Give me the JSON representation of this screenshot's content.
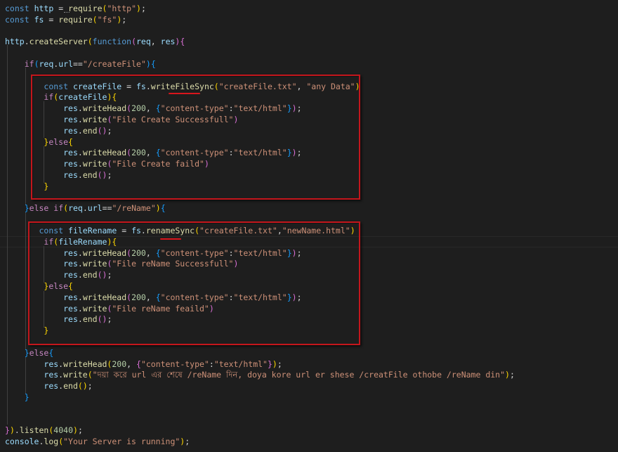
{
  "editor": {
    "lines": [
      [
        {
          "t": "const",
          "c": "kw"
        },
        {
          "t": " ",
          "c": "p"
        },
        {
          "t": "http",
          "c": "var"
        },
        {
          "t": " = ",
          "c": "p"
        },
        {
          "t": "require",
          "c": "fn"
        },
        {
          "t": "(",
          "c": "b1"
        },
        {
          "t": "\"http\"",
          "c": "str"
        },
        {
          "t": ")",
          "c": "b1"
        },
        {
          "t": ";",
          "c": "p"
        }
      ],
      [
        {
          "t": "const",
          "c": "kw"
        },
        {
          "t": " ",
          "c": "p"
        },
        {
          "t": "fs",
          "c": "var"
        },
        {
          "t": " = ",
          "c": "p"
        },
        {
          "t": "require",
          "c": "fn"
        },
        {
          "t": "(",
          "c": "b1"
        },
        {
          "t": "\"fs\"",
          "c": "str"
        },
        {
          "t": ")",
          "c": "b1"
        },
        {
          "t": ";",
          "c": "p"
        }
      ],
      [],
      [
        {
          "t": "http",
          "c": "var"
        },
        {
          "t": ".",
          "c": "p"
        },
        {
          "t": "createServer",
          "c": "fn"
        },
        {
          "t": "(",
          "c": "b1"
        },
        {
          "t": "function",
          "c": "kw"
        },
        {
          "t": "(",
          "c": "b2"
        },
        {
          "t": "req",
          "c": "var"
        },
        {
          "t": ", ",
          "c": "p"
        },
        {
          "t": "res",
          "c": "var"
        },
        {
          "t": ")",
          "c": "b2"
        },
        {
          "t": "{",
          "c": "b2"
        }
      ],
      [],
      [
        {
          "t": "    ",
          "c": "p"
        },
        {
          "t": "if",
          "c": "ctl"
        },
        {
          "t": "(",
          "c": "b3"
        },
        {
          "t": "req",
          "c": "var"
        },
        {
          "t": ".",
          "c": "p"
        },
        {
          "t": "url",
          "c": "var"
        },
        {
          "t": "==",
          "c": "p"
        },
        {
          "t": "\"/createFile\"",
          "c": "str"
        },
        {
          "t": ")",
          "c": "b3"
        },
        {
          "t": "{",
          "c": "b3"
        }
      ],
      [],
      [
        {
          "t": "        ",
          "c": "p"
        },
        {
          "t": "const",
          "c": "kw"
        },
        {
          "t": " ",
          "c": "p"
        },
        {
          "t": "createFile",
          "c": "var"
        },
        {
          "t": " = ",
          "c": "p"
        },
        {
          "t": "fs",
          "c": "var"
        },
        {
          "t": ".",
          "c": "p"
        },
        {
          "t": "writeFileSync",
          "c": "fn"
        },
        {
          "t": "(",
          "c": "b1"
        },
        {
          "t": "\"createFile.txt\"",
          "c": "str"
        },
        {
          "t": ", ",
          "c": "p"
        },
        {
          "t": "\"any Data\"",
          "c": "str"
        },
        {
          "t": ")",
          "c": "b1"
        }
      ],
      [
        {
          "t": "        ",
          "c": "p"
        },
        {
          "t": "if",
          "c": "ctl"
        },
        {
          "t": "(",
          "c": "b1"
        },
        {
          "t": "createFile",
          "c": "var"
        },
        {
          "t": ")",
          "c": "b1"
        },
        {
          "t": "{",
          "c": "b1"
        }
      ],
      [
        {
          "t": "            ",
          "c": "p"
        },
        {
          "t": "res",
          "c": "var"
        },
        {
          "t": ".",
          "c": "p"
        },
        {
          "t": "writeHead",
          "c": "fn"
        },
        {
          "t": "(",
          "c": "b2"
        },
        {
          "t": "200",
          "c": "num"
        },
        {
          "t": ", ",
          "c": "p"
        },
        {
          "t": "{",
          "c": "b3"
        },
        {
          "t": "\"content-type\"",
          "c": "str"
        },
        {
          "t": ":",
          "c": "p"
        },
        {
          "t": "\"text/html\"",
          "c": "str"
        },
        {
          "t": "}",
          "c": "b3"
        },
        {
          "t": ")",
          "c": "b2"
        },
        {
          "t": ";",
          "c": "p"
        }
      ],
      [
        {
          "t": "            ",
          "c": "p"
        },
        {
          "t": "res",
          "c": "var"
        },
        {
          "t": ".",
          "c": "p"
        },
        {
          "t": "write",
          "c": "fn"
        },
        {
          "t": "(",
          "c": "b2"
        },
        {
          "t": "\"File Create Successfull\"",
          "c": "str"
        },
        {
          "t": ")",
          "c": "b2"
        }
      ],
      [
        {
          "t": "            ",
          "c": "p"
        },
        {
          "t": "res",
          "c": "var"
        },
        {
          "t": ".",
          "c": "p"
        },
        {
          "t": "end",
          "c": "fn"
        },
        {
          "t": "(",
          "c": "b2"
        },
        {
          "t": ")",
          "c": "b2"
        },
        {
          "t": ";",
          "c": "p"
        }
      ],
      [
        {
          "t": "        ",
          "c": "p"
        },
        {
          "t": "}",
          "c": "b1"
        },
        {
          "t": "else",
          "c": "ctl"
        },
        {
          "t": "{",
          "c": "b1"
        }
      ],
      [
        {
          "t": "            ",
          "c": "p"
        },
        {
          "t": "res",
          "c": "var"
        },
        {
          "t": ".",
          "c": "p"
        },
        {
          "t": "writeHead",
          "c": "fn"
        },
        {
          "t": "(",
          "c": "b2"
        },
        {
          "t": "200",
          "c": "num"
        },
        {
          "t": ", ",
          "c": "p"
        },
        {
          "t": "{",
          "c": "b3"
        },
        {
          "t": "\"content-type\"",
          "c": "str"
        },
        {
          "t": ":",
          "c": "p"
        },
        {
          "t": "\"text/html\"",
          "c": "str"
        },
        {
          "t": "}",
          "c": "b3"
        },
        {
          "t": ")",
          "c": "b2"
        },
        {
          "t": ";",
          "c": "p"
        }
      ],
      [
        {
          "t": "            ",
          "c": "p"
        },
        {
          "t": "res",
          "c": "var"
        },
        {
          "t": ".",
          "c": "p"
        },
        {
          "t": "write",
          "c": "fn"
        },
        {
          "t": "(",
          "c": "b2"
        },
        {
          "t": "\"File Create faild\"",
          "c": "str"
        },
        {
          "t": ")",
          "c": "b2"
        }
      ],
      [
        {
          "t": "            ",
          "c": "p"
        },
        {
          "t": "res",
          "c": "var"
        },
        {
          "t": ".",
          "c": "p"
        },
        {
          "t": "end",
          "c": "fn"
        },
        {
          "t": "(",
          "c": "b2"
        },
        {
          "t": ")",
          "c": "b2"
        },
        {
          "t": ";",
          "c": "p"
        }
      ],
      [
        {
          "t": "        ",
          "c": "p"
        },
        {
          "t": "}",
          "c": "b1"
        }
      ],
      [],
      [
        {
          "t": "    ",
          "c": "p"
        },
        {
          "t": "}",
          "c": "b3"
        },
        {
          "t": "else",
          "c": "ctl"
        },
        {
          "t": " ",
          "c": "p"
        },
        {
          "t": "if",
          "c": "ctl"
        },
        {
          "t": "(",
          "c": "b1"
        },
        {
          "t": "req",
          "c": "var"
        },
        {
          "t": ".",
          "c": "p"
        },
        {
          "t": "url",
          "c": "var"
        },
        {
          "t": "==",
          "c": "p"
        },
        {
          "t": "\"/reName\"",
          "c": "str"
        },
        {
          "t": ")",
          "c": "b1"
        },
        {
          "t": "{",
          "c": "b3"
        }
      ],
      [],
      [
        {
          "t": "       ",
          "c": "p"
        },
        {
          "t": "const",
          "c": "kw"
        },
        {
          "t": " ",
          "c": "p"
        },
        {
          "t": "fileRename",
          "c": "var"
        },
        {
          "t": " = ",
          "c": "p"
        },
        {
          "t": "fs",
          "c": "var"
        },
        {
          "t": ".",
          "c": "p"
        },
        {
          "t": "renameSync",
          "c": "fn"
        },
        {
          "t": "(",
          "c": "b1"
        },
        {
          "t": "\"createFile.txt\"",
          "c": "str"
        },
        {
          "t": ",",
          "c": "p"
        },
        {
          "t": "\"newName.html\"",
          "c": "str"
        },
        {
          "t": ")",
          "c": "b1"
        }
      ],
      [
        {
          "t": "        ",
          "c": "p"
        },
        {
          "t": "if",
          "c": "ctl"
        },
        {
          "t": "(",
          "c": "b1"
        },
        {
          "t": "fileRename",
          "c": "var"
        },
        {
          "t": ")",
          "c": "b1"
        },
        {
          "t": "{",
          "c": "b1"
        }
      ],
      [
        {
          "t": "            ",
          "c": "p"
        },
        {
          "t": "res",
          "c": "var"
        },
        {
          "t": ".",
          "c": "p"
        },
        {
          "t": "writeHead",
          "c": "fn"
        },
        {
          "t": "(",
          "c": "b2"
        },
        {
          "t": "200",
          "c": "num"
        },
        {
          "t": ", ",
          "c": "p"
        },
        {
          "t": "{",
          "c": "b3"
        },
        {
          "t": "\"content-type\"",
          "c": "str"
        },
        {
          "t": ":",
          "c": "p"
        },
        {
          "t": "\"text/html\"",
          "c": "str"
        },
        {
          "t": "}",
          "c": "b3"
        },
        {
          "t": ")",
          "c": "b2"
        },
        {
          "t": ";",
          "c": "p"
        }
      ],
      [
        {
          "t": "            ",
          "c": "p"
        },
        {
          "t": "res",
          "c": "var"
        },
        {
          "t": ".",
          "c": "p"
        },
        {
          "t": "write",
          "c": "fn"
        },
        {
          "t": "(",
          "c": "b2"
        },
        {
          "t": "\"File reName Successfull\"",
          "c": "str"
        },
        {
          "t": ")",
          "c": "b2"
        }
      ],
      [
        {
          "t": "            ",
          "c": "p"
        },
        {
          "t": "res",
          "c": "var"
        },
        {
          "t": ".",
          "c": "p"
        },
        {
          "t": "end",
          "c": "fn"
        },
        {
          "t": "(",
          "c": "b2"
        },
        {
          "t": ")",
          "c": "b2"
        },
        {
          "t": ";",
          "c": "p"
        }
      ],
      [
        {
          "t": "        ",
          "c": "p"
        },
        {
          "t": "}",
          "c": "b1"
        },
        {
          "t": "else",
          "c": "ctl"
        },
        {
          "t": "{",
          "c": "b1"
        }
      ],
      [
        {
          "t": "            ",
          "c": "p"
        },
        {
          "t": "res",
          "c": "var"
        },
        {
          "t": ".",
          "c": "p"
        },
        {
          "t": "writeHead",
          "c": "fn"
        },
        {
          "t": "(",
          "c": "b2"
        },
        {
          "t": "200",
          "c": "num"
        },
        {
          "t": ", ",
          "c": "p"
        },
        {
          "t": "{",
          "c": "b3"
        },
        {
          "t": "\"content-type\"",
          "c": "str"
        },
        {
          "t": ":",
          "c": "p"
        },
        {
          "t": "\"text/html\"",
          "c": "str"
        },
        {
          "t": "}",
          "c": "b3"
        },
        {
          "t": ")",
          "c": "b2"
        },
        {
          "t": ";",
          "c": "p"
        }
      ],
      [
        {
          "t": "            ",
          "c": "p"
        },
        {
          "t": "res",
          "c": "var"
        },
        {
          "t": ".",
          "c": "p"
        },
        {
          "t": "write",
          "c": "fn"
        },
        {
          "t": "(",
          "c": "b2"
        },
        {
          "t": "\"File reName feaild\"",
          "c": "str"
        },
        {
          "t": ")",
          "c": "b2"
        }
      ],
      [
        {
          "t": "            ",
          "c": "p"
        },
        {
          "t": "res",
          "c": "var"
        },
        {
          "t": ".",
          "c": "p"
        },
        {
          "t": "end",
          "c": "fn"
        },
        {
          "t": "(",
          "c": "b2"
        },
        {
          "t": ")",
          "c": "b2"
        },
        {
          "t": ";",
          "c": "p"
        }
      ],
      [
        {
          "t": "        ",
          "c": "p"
        },
        {
          "t": "}",
          "c": "b1"
        }
      ],
      [],
      [
        {
          "t": "    ",
          "c": "p"
        },
        {
          "t": "}",
          "c": "b3"
        },
        {
          "t": "else",
          "c": "ctl"
        },
        {
          "t": "{",
          "c": "b3"
        }
      ],
      [
        {
          "t": "        ",
          "c": "p"
        },
        {
          "t": "res",
          "c": "var"
        },
        {
          "t": ".",
          "c": "p"
        },
        {
          "t": "writeHead",
          "c": "fn"
        },
        {
          "t": "(",
          "c": "b1"
        },
        {
          "t": "200",
          "c": "num"
        },
        {
          "t": ", ",
          "c": "p"
        },
        {
          "t": "{",
          "c": "b2"
        },
        {
          "t": "\"content-type\"",
          "c": "str"
        },
        {
          "t": ":",
          "c": "p"
        },
        {
          "t": "\"text/html\"",
          "c": "str"
        },
        {
          "t": "}",
          "c": "b2"
        },
        {
          "t": ")",
          "c": "b1"
        },
        {
          "t": ";",
          "c": "p"
        }
      ],
      [
        {
          "t": "        ",
          "c": "p"
        },
        {
          "t": "res",
          "c": "var"
        },
        {
          "t": ".",
          "c": "p"
        },
        {
          "t": "write",
          "c": "fn"
        },
        {
          "t": "(",
          "c": "b1"
        },
        {
          "t": "\"দয়া করে url এর শেষে /reName দিন, doya kore url er shese /creatFile othobe /reName din\"",
          "c": "str"
        },
        {
          "t": ")",
          "c": "b1"
        },
        {
          "t": ";",
          "c": "p"
        }
      ],
      [
        {
          "t": "        ",
          "c": "p"
        },
        {
          "t": "res",
          "c": "var"
        },
        {
          "t": ".",
          "c": "p"
        },
        {
          "t": "end",
          "c": "fn"
        },
        {
          "t": "(",
          "c": "b1"
        },
        {
          "t": ")",
          "c": "b1"
        },
        {
          "t": ";",
          "c": "p"
        }
      ],
      [
        {
          "t": "    ",
          "c": "p"
        },
        {
          "t": "}",
          "c": "b3"
        }
      ],
      [],
      [],
      [
        {
          "t": "}",
          "c": "b2"
        },
        {
          "t": ")",
          "c": "b1"
        },
        {
          "t": ".",
          "c": "p"
        },
        {
          "t": "listen",
          "c": "fn"
        },
        {
          "t": "(",
          "c": "b1"
        },
        {
          "t": "4040",
          "c": "num"
        },
        {
          "t": ")",
          "c": "b1"
        },
        {
          "t": ";",
          "c": "p"
        }
      ],
      [
        {
          "t": "console",
          "c": "var"
        },
        {
          "t": ".",
          "c": "p"
        },
        {
          "t": "log",
          "c": "fn"
        },
        {
          "t": "(",
          "c": "b1"
        },
        {
          "t": "\"Your Server is running\"",
          "c": "str"
        },
        {
          "t": ")",
          "c": "b1"
        },
        {
          "t": ";",
          "c": "p"
        }
      ]
    ]
  },
  "annotations": {
    "highlight_color": "#c4161c"
  },
  "theme": {
    "background": "#1e1e1e",
    "keyword": "#569cd6",
    "control": "#c586c0",
    "variable": "#9cdcfe",
    "function": "#dcdcaa",
    "string": "#ce9178",
    "number": "#b5cea8",
    "bracket_level1": "#ffd700",
    "bracket_level2": "#da70d6",
    "bracket_level3": "#179fff"
  }
}
